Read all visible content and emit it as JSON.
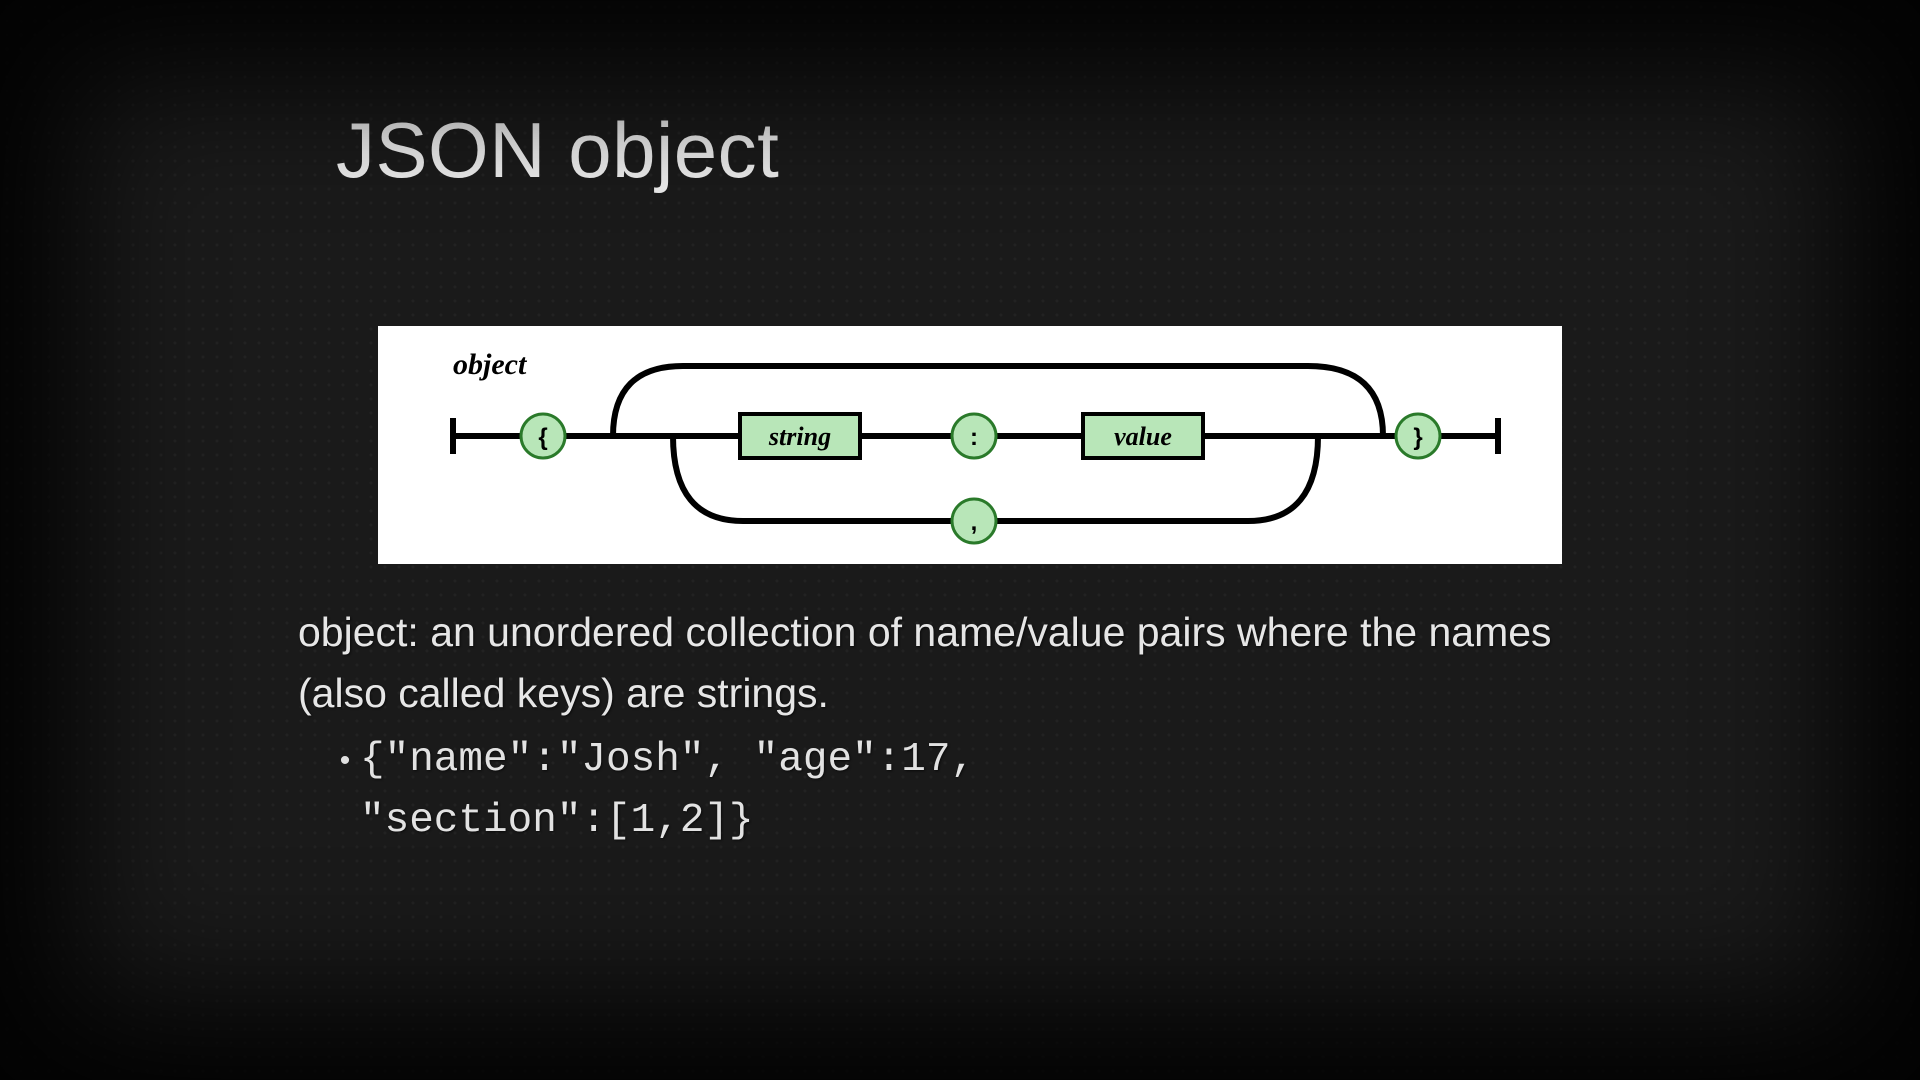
{
  "slide": {
    "title": "JSON object",
    "description": " object: an unordered collection of name/value pairs where the names (also called keys) are strings.",
    "bullet_code": "{\"name\":\"Josh\", \"age\":17,\n\"section\":[1,2]}"
  },
  "diagram": {
    "label": "object",
    "nodes": {
      "open_brace": "{",
      "string_box": "string",
      "colon": ":",
      "value_box": "value",
      "comma": ",",
      "close_brace": "}"
    },
    "colors": {
      "node_fill": "#b8e6b8",
      "node_stroke": "#2a7a2a",
      "rail_stroke": "#000000",
      "box_stroke": "#000000"
    }
  }
}
